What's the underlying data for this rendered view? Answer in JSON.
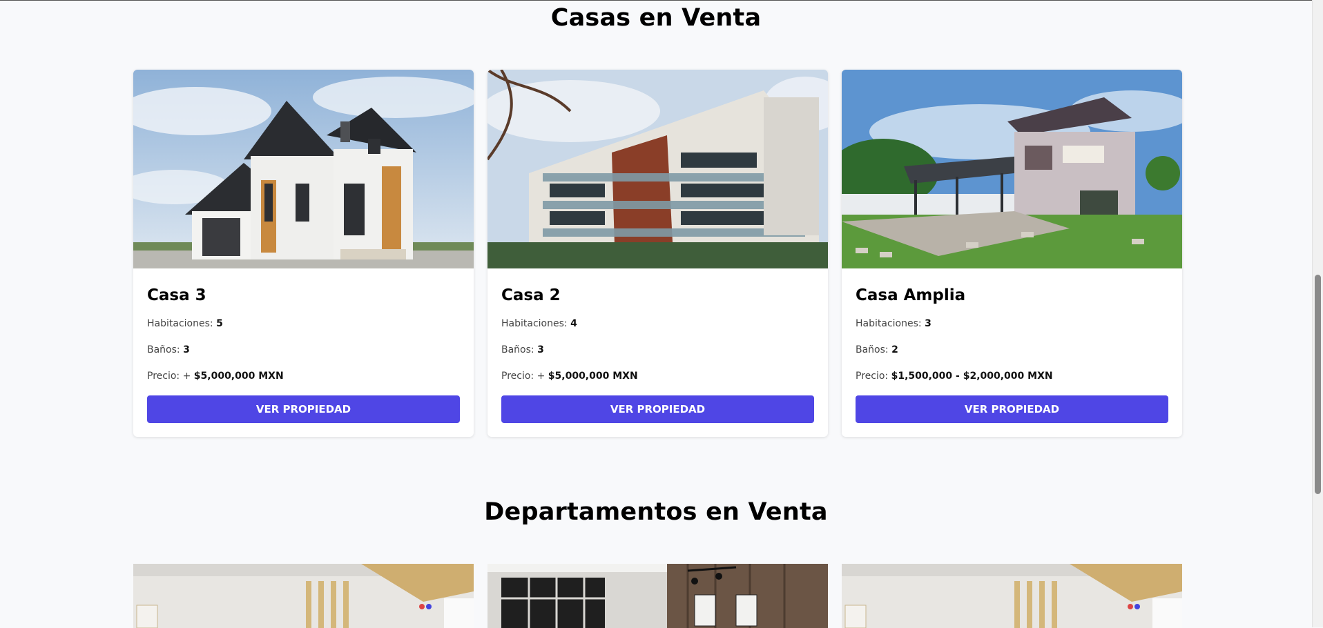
{
  "casas": {
    "title": "Casas en Venta",
    "cards": [
      {
        "title": "Casa 3",
        "rooms_label": "Habitaciones:",
        "rooms": "5",
        "baths_label": "Baños:",
        "baths": "3",
        "price_label": "Precio:",
        "price_prefix": "+",
        "price": "$5,000,000 MXN",
        "button": "VER PROPIEDAD",
        "image": "house-photo"
      },
      {
        "title": "Casa 2",
        "rooms_label": "Habitaciones:",
        "rooms": "4",
        "baths_label": "Baños:",
        "baths": "3",
        "price_label": "Precio:",
        "price_prefix": "+",
        "price": "$5,000,000 MXN",
        "button": "VER PROPIEDAD",
        "image": "apartment-building-photo"
      },
      {
        "title": "Casa Amplia",
        "rooms_label": "Habitaciones:",
        "rooms": "3",
        "baths_label": "Baños:",
        "baths": "2",
        "price_label": "Precio:",
        "price_prefix": "",
        "price": "$1,500,000 - $2,000,000 MXN",
        "button": "VER PROPIEDAD",
        "image": "modern-house-garden-photo"
      }
    ]
  },
  "departamentos": {
    "title": "Departamentos en Venta",
    "images": [
      "apartment-interior-photo",
      "loft-interior-photo",
      "apartment-interior-photo"
    ]
  },
  "colors": {
    "accent": "#4f46e5",
    "background": "#f8f9fb"
  }
}
